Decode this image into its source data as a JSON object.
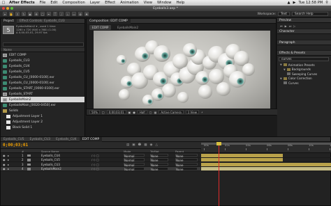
{
  "menubar": {
    "app_name": "After Effects",
    "items": [
      "File",
      "Edit",
      "Composition",
      "Layer",
      "Effect",
      "Animation",
      "View",
      "Window",
      "Help"
    ],
    "clock": "Tue 12:58 PM"
  },
  "window": {
    "title": "Eyeballs3.aep *"
  },
  "toolbar": {
    "workspace_label": "Workspace:",
    "workspace_value": "Text",
    "search_placeholder": "Search Help"
  },
  "project": {
    "tabs": [
      "Project",
      "Effect Controls: Eyeballs_CU3"
    ],
    "info_name": "EyeballsMain2 ▾ , used 1 time",
    "info_size": "1280 x 720 (640 x 360) (1.00)",
    "info_duration": "Δ 0;00;03;01, 29.97 fps",
    "header": "Name",
    "items": [
      {
        "type": "comp",
        "name": "EDIT COMP",
        "selected": false
      },
      {
        "type": "exr",
        "name": "Eyeballs_CU3",
        "selected": false
      },
      {
        "type": "exr",
        "name": "Eyeballs_CU4",
        "selected": false
      },
      {
        "type": "exr",
        "name": "Eyeballs_CU5",
        "selected": false
      },
      {
        "type": "exr",
        "name": "Eyeballs_CU_[0000-0100].exr",
        "selected": false
      },
      {
        "type": "exr",
        "name": "Eyeballs_CU_[0000-0100].exr",
        "selected": false
      },
      {
        "type": "exr",
        "name": "Eyeballs_START_[0000-0100].exr",
        "selected": false
      },
      {
        "type": "comp",
        "name": "Eyeballs_START",
        "selected": false
      },
      {
        "type": "comp",
        "name": "EyeballsMain2",
        "selected": true
      },
      {
        "type": "exr",
        "name": "EyeballsMain_[0020-0450].exr",
        "selected": false
      },
      {
        "type": "folder",
        "name": "Solids",
        "selected": false
      },
      {
        "type": "solid",
        "name": "Adjustment Layer 1",
        "selected": false
      },
      {
        "type": "solid",
        "name": "Adjustment Layer 2",
        "selected": false
      },
      {
        "type": "solid",
        "name": "Black Solid 1",
        "selected": false
      }
    ],
    "bpc": "16 bpc"
  },
  "composition": {
    "panel_tab": "Composition: EDIT COMP",
    "subtabs": [
      "EDIT COMP",
      "EyeballsMain2"
    ],
    "zoom": "50%",
    "timecode": "0;00;03;01",
    "resolution": "Half",
    "camera": "Active Camera",
    "views": "1 View"
  },
  "right_panels": {
    "preview_title": "Preview",
    "character_title": "Character",
    "paragraph_title": "Paragraph",
    "effects_title": "Effects & Presets",
    "effects_search": "curves",
    "effects": [
      {
        "label": "Animation Presets",
        "indent": 0,
        "kind": "group"
      },
      {
        "label": "Backgrounds",
        "indent": 1,
        "kind": "folder"
      },
      {
        "label": "Sweeping Curves",
        "indent": 2,
        "kind": "item"
      },
      {
        "label": "Color Correction",
        "indent": 0,
        "kind": "group"
      },
      {
        "label": "Curves",
        "indent": 1,
        "kind": "item"
      }
    ]
  },
  "timeline": {
    "tabs": [
      "Eyeballs_CU5",
      "Eyeballs_CU3",
      "Eyeballs_CU4",
      "EDIT COMP"
    ],
    "timecode": "0;00;03;01",
    "columns": {
      "num": "#",
      "source": "Source Name",
      "mode": "Mode",
      "trkmat": "TrkMat",
      "parent": "Parent"
    },
    "layers": [
      {
        "num": "1",
        "name": "Eyeballs_CU4",
        "mode": "Normal",
        "trkmat": "None",
        "parent": "None",
        "selected": false
      },
      {
        "num": "2",
        "name": "Eyeballs_CU5",
        "mode": "Normal",
        "trkmat": "None",
        "parent": "None",
        "selected": false
      },
      {
        "num": "3",
        "name": "Eyeballs_CU3",
        "mode": "Normal",
        "trkmat": "None",
        "parent": "None",
        "selected": false
      },
      {
        "num": "4",
        "name": "EyeballsMain2",
        "mode": "Normal",
        "trkmat": "None",
        "parent": "None",
        "selected": true
      }
    ],
    "ruler_labels": [
      "00s",
      "02s",
      "04s",
      "06s",
      "08s",
      "10s",
      "12s"
    ],
    "colors": {
      "layer_bar": "#b9a24a",
      "selected_bar": "#c6bd86",
      "playhead": "#e02a2a"
    }
  }
}
